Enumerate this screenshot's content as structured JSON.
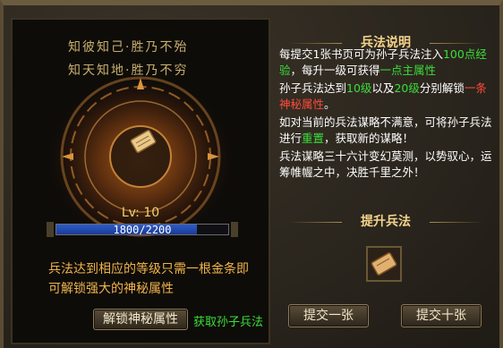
{
  "left": {
    "poem_line1": "知彼知己·胜乃不殆",
    "poem_line2": "知天知地·胜乃不穷",
    "level_label": "Lv:  10",
    "progress": {
      "text": "1800/2200",
      "current": 1800,
      "max": 2200
    },
    "unlock_text": "兵法达到相应的等级只需一根金条即可解锁强大的神秘属性",
    "unlock_button": "解锁神秘属性",
    "get_link": "获取孙子兵法"
  },
  "right": {
    "info_title": "兵法说明",
    "desc": {
      "p1_a": "每提交1张书页可为孙子兵法注入",
      "p1_b": "100点经验",
      "p1_c": "，每升一级可获得",
      "p1_d": "一点主属性",
      "p2_a": "孙子兵法达到",
      "p2_b": "10级",
      "p2_c": "以及",
      "p2_d": "20级",
      "p2_e": "分别解锁",
      "p2_f": "一条神秘属性",
      "p2_g": "。",
      "p3_a": "如对当前的兵法谋略不满意，可将孙子兵法进行",
      "p3_b": "重置",
      "p3_c": "，获取新的谋略！",
      "p4": "兵法谋略三十六计变幻莫测，以势驭心，运筹帷幄之中，决胜千里之外！"
    },
    "upgrade_title": "提升兵法",
    "submit_one": "提交一张",
    "submit_ten": "提交十张"
  },
  "colors": {
    "green": "#3adf3a",
    "red": "#ff4a3a",
    "gold": "#f0d36a",
    "bar_blue": "#2d5cc7"
  }
}
